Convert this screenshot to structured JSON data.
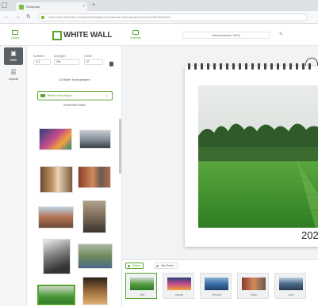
{
  "browser": {
    "tab_title": "Whitewall",
    "url": "https://www.whitewall.com/calendar/designer/wall-calendar-a3/landscape?product=WallCalendarA3"
  },
  "toolbar": {
    "back_label": "Zurück",
    "logo_text": "WHITE WALL",
    "preview_label": "Vorschau",
    "project_name": "Wandkalender 2024"
  },
  "rail": {
    "images_label": "Bilder",
    "layouts_label": "Layouts"
  },
  "panel": {
    "sort_label": "Sortieren",
    "sort_value": "A-Z",
    "filter_label": "Anzeigen",
    "filter_value": "Alle",
    "size_label": "Größe",
    "size_value": "M",
    "count_text": "11 Bilder hochgeladen",
    "add_button": "Bilder hinzufügen",
    "usage_text": "Verwendete Bilder"
  },
  "calendar": {
    "year_text": "2024"
  },
  "bottom": {
    "tab_pages": "Seiten",
    "tab_all": "Alle Seiten",
    "pages": [
      {
        "label": "Titel"
      },
      {
        "label": "Januar"
      },
      {
        "label": "Februar"
      },
      {
        "label": "März"
      },
      {
        "label": "April"
      }
    ]
  },
  "colors": {
    "accent": "#58a52d",
    "rail_active": "#5a5f66"
  }
}
